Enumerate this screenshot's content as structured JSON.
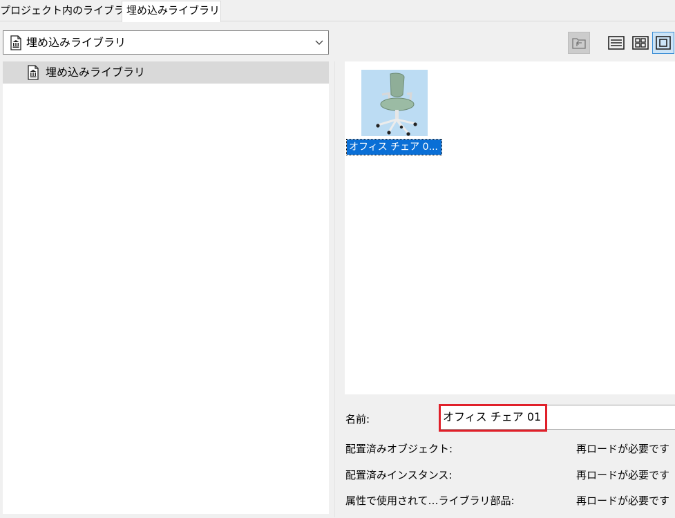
{
  "tabs": [
    {
      "label": "プロジェクト内のライブラリ",
      "active": false
    },
    {
      "label": "埋め込みライブラリ",
      "active": true
    }
  ],
  "library_dropdown": {
    "selected": "埋め込みライブラリ",
    "icon": "library-icon"
  },
  "toolbar": {
    "icons": [
      "folder-up-icon",
      "list-view-icon",
      "grid-view-icon",
      "large-icon-view-icon"
    ],
    "active_view": "large-icon-view"
  },
  "tree": {
    "items": [
      {
        "label": "埋め込みライブラリ",
        "icon": "library-icon",
        "selected": true
      }
    ]
  },
  "preview": {
    "items": [
      {
        "label": "オフィス チェア 0...",
        "icon": "office-chair-thumbnail",
        "selected": true
      }
    ]
  },
  "info": {
    "name_label": "名前:",
    "name_value": "オフィス チェア 01",
    "rows": [
      {
        "label": "配置済みオブジェクト:",
        "value": "再ロードが必要です"
      },
      {
        "label": "配置済みインスタンス:",
        "value": "再ロードが必要です"
      },
      {
        "label": "属性で使用されて…ライブラリ部品:",
        "value": "再ロードが必要です"
      }
    ]
  },
  "colors": {
    "selection": "#0a6fd6",
    "highlight": "#e0202a",
    "thumb_bg": "#bcdcf3",
    "active_view_bg": "#cce4f7"
  }
}
